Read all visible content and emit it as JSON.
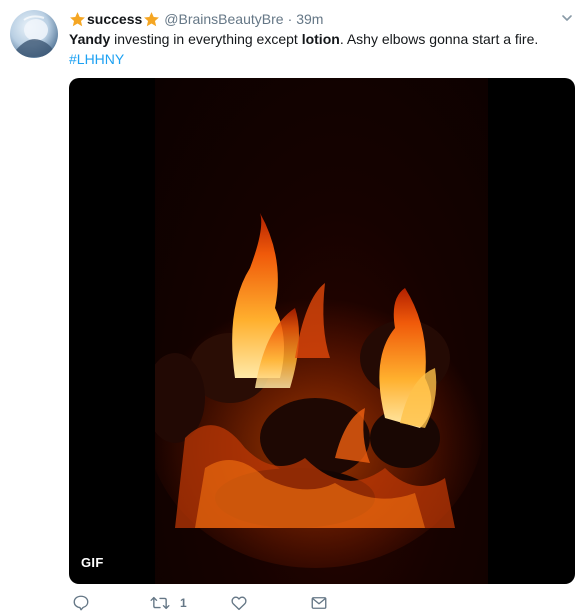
{
  "tweet": {
    "display_name": "success",
    "handle": "@BrainsBeautyBre",
    "separator": "·",
    "time": "39m",
    "text_parts": {
      "bold_1": "Yandy",
      "plain_1": " investing in everything except ",
      "bold_2": "lotion",
      "plain_2": ". Ashy elbows gonna start a fire."
    },
    "hashtag": "#LHHNY",
    "media": {
      "badge": "GIF"
    },
    "actions": {
      "reply_icon": "reply-icon",
      "retweet_icon": "retweet-icon",
      "retweet_count": "1",
      "like_icon": "heart-icon",
      "dm_icon": "envelope-icon"
    },
    "colors": {
      "link": "#1da1f2",
      "meta": "#657786",
      "star": "#f5a623"
    }
  }
}
